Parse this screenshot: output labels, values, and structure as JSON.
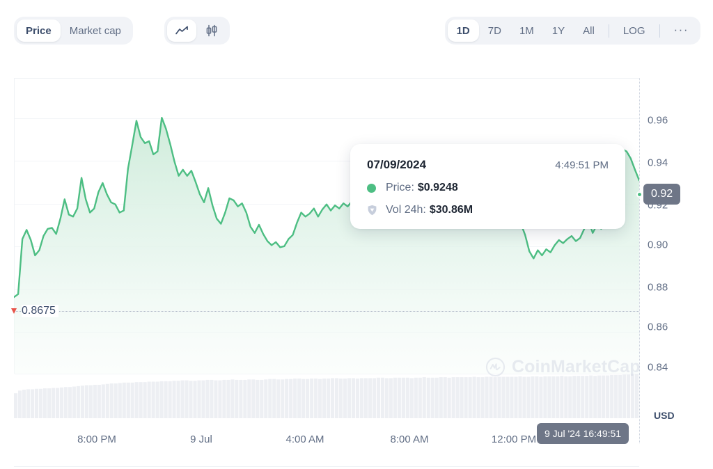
{
  "toolbar": {
    "metric_options": [
      {
        "label": "Price",
        "active": true
      },
      {
        "label": "Market cap",
        "active": false
      }
    ],
    "chart_type_options": [
      {
        "icon": "line-chart-icon",
        "active": true
      },
      {
        "icon": "candlestick-chart-icon",
        "active": false
      }
    ],
    "range_options": [
      {
        "label": "1D",
        "active": true
      },
      {
        "label": "7D",
        "active": false
      },
      {
        "label": "1M",
        "active": false
      },
      {
        "label": "1Y",
        "active": false
      },
      {
        "label": "All",
        "active": false
      }
    ],
    "log_label": "LOG",
    "more_label": "···"
  },
  "tooltip": {
    "date": "07/09/2024",
    "time": "4:49:51 PM",
    "price_key": "Price:",
    "price_value": "$0.9248",
    "volume_key": "Vol 24h:",
    "volume_value": "$30.86M",
    "price_dot_color": "#4DBE83",
    "volume_icon": "shield-icon"
  },
  "axis": {
    "y_label_unit": "USD",
    "y_ticks": [
      "0.96",
      "0.94",
      "0.92",
      "0.90",
      "0.88",
      "0.86",
      "0.84"
    ],
    "x_ticks": [
      "8:00 PM",
      "9 Jul",
      "4:00 AM",
      "8:00 AM",
      "12:00 PM"
    ],
    "current_price_badge": "0.92",
    "crosshair_time_badge": "9 Jul '24 16:49:51",
    "low_marker_label": "0.8675"
  },
  "watermark": {
    "text": "CoinMarketCap",
    "logo": "coinmarketcap-logo-icon"
  },
  "colors": {
    "line": "#4DBE83",
    "area_top": "#CDEBD9",
    "area_bottom": "#F4FBF7",
    "badge": "#6E7687",
    "low_marker": "#E8544A",
    "grid": "#F3F5F8",
    "text_muted": "#616E85",
    "volume_bar": "#EDEFF3"
  },
  "chart_data": {
    "type": "area",
    "title": "",
    "xlabel": "",
    "ylabel": "USD",
    "ylim": [
      0.83,
      0.975
    ],
    "grid": true,
    "legend": "none",
    "series": [
      {
        "name": "Price",
        "unit": "USD",
        "values": [
          0.8675,
          0.869,
          0.896,
          0.9005,
          0.8955,
          0.888,
          0.8905,
          0.8975,
          0.901,
          0.9015,
          0.8985,
          0.906,
          0.9155,
          0.908,
          0.907,
          0.911,
          0.926,
          0.9155,
          0.909,
          0.911,
          0.919,
          0.9235,
          0.918,
          0.914,
          0.913,
          0.909,
          0.91,
          0.9305,
          0.942,
          0.954,
          0.946,
          0.943,
          0.944,
          0.9375,
          0.939,
          0.9555,
          0.95,
          0.9425,
          0.934,
          0.927,
          0.93,
          0.927,
          0.9295,
          0.924,
          0.918,
          0.914,
          0.921,
          0.9125,
          0.906,
          0.9035,
          0.909,
          0.916,
          0.915,
          0.912,
          0.9135,
          0.909,
          0.902,
          0.899,
          0.903,
          0.8985,
          0.895,
          0.893,
          0.8945,
          0.892,
          0.8925,
          0.896,
          0.898,
          0.904,
          0.909,
          0.907,
          0.9085,
          0.911,
          0.907,
          0.9105,
          0.913,
          0.91,
          0.9125,
          0.911,
          0.9135,
          0.912,
          0.9145,
          0.913,
          0.9155,
          0.914,
          0.9175,
          0.916,
          0.9185,
          0.9175,
          0.92,
          0.924,
          0.93,
          0.927,
          0.933,
          0.929,
          0.925,
          0.929,
          0.9345,
          0.938,
          0.9355,
          0.933,
          0.931,
          0.929,
          0.932,
          0.93,
          0.928,
          0.931,
          0.929,
          0.9265,
          0.923,
          0.915,
          0.909,
          0.9065,
          0.907,
          0.904,
          0.905,
          0.9085,
          0.9095,
          0.908,
          0.907,
          0.9045,
          0.9035,
          0.898,
          0.89,
          0.8865,
          0.8905,
          0.888,
          0.891,
          0.8895,
          0.893,
          0.8955,
          0.894,
          0.896,
          0.8975,
          0.895,
          0.8965,
          0.901,
          0.905,
          0.899,
          0.903,
          0.901,
          0.9065,
          0.911,
          0.93,
          0.936,
          0.94,
          0.939,
          0.9355,
          0.93,
          0.9248
        ]
      }
    ],
    "volume": {
      "name": "Vol 24h",
      "values": [
        0.56,
        0.62,
        0.64,
        0.65,
        0.65,
        0.66,
        0.66,
        0.67,
        0.67,
        0.68,
        0.68,
        0.69,
        0.7,
        0.7,
        0.71,
        0.72,
        0.73,
        0.74,
        0.74,
        0.75,
        0.75,
        0.76,
        0.77,
        0.78,
        0.78,
        0.79,
        0.8,
        0.8,
        0.8,
        0.81,
        0.81,
        0.81,
        0.82,
        0.82,
        0.82,
        0.83,
        0.83,
        0.83,
        0.84,
        0.84,
        0.85,
        0.85,
        0.84,
        0.84,
        0.85,
        0.85,
        0.86,
        0.86,
        0.85,
        0.85,
        0.86,
        0.86,
        0.87,
        0.86,
        0.86,
        0.86,
        0.87,
        0.87,
        0.86,
        0.86,
        0.87,
        0.88,
        0.88,
        0.87,
        0.87,
        0.88,
        0.88,
        0.89,
        0.89,
        0.88,
        0.88,
        0.89,
        0.89,
        0.88,
        0.89,
        0.89,
        0.9,
        0.9,
        0.89,
        0.89,
        0.9,
        0.9,
        0.89,
        0.9,
        0.9,
        0.9,
        0.9,
        0.91,
        0.91,
        0.9,
        0.9,
        0.91,
        0.91,
        0.91,
        0.91,
        0.9,
        0.91,
        0.91,
        0.92,
        0.91,
        0.91,
        0.91,
        0.92,
        0.92,
        0.91,
        0.92,
        0.92,
        0.92,
        0.92,
        0.92,
        0.93,
        0.92,
        0.92,
        0.93,
        0.93,
        0.92,
        0.93,
        0.93,
        0.93,
        0.93,
        0.93,
        0.94,
        0.93,
        0.93,
        0.94,
        0.94,
        0.93,
        0.94,
        0.94,
        0.94,
        0.94,
        0.95,
        0.94,
        0.94,
        0.95,
        0.95,
        0.95,
        0.95,
        0.96,
        0.95,
        0.96,
        0.96,
        0.96,
        0.97,
        0.97,
        0.97,
        0.98,
        0.98,
        0.99,
        1.0
      ]
    },
    "markers": {
      "low": {
        "label": "0.8675",
        "value": 0.8675
      },
      "current": {
        "label": "0.92",
        "value": 0.9248
      }
    }
  }
}
